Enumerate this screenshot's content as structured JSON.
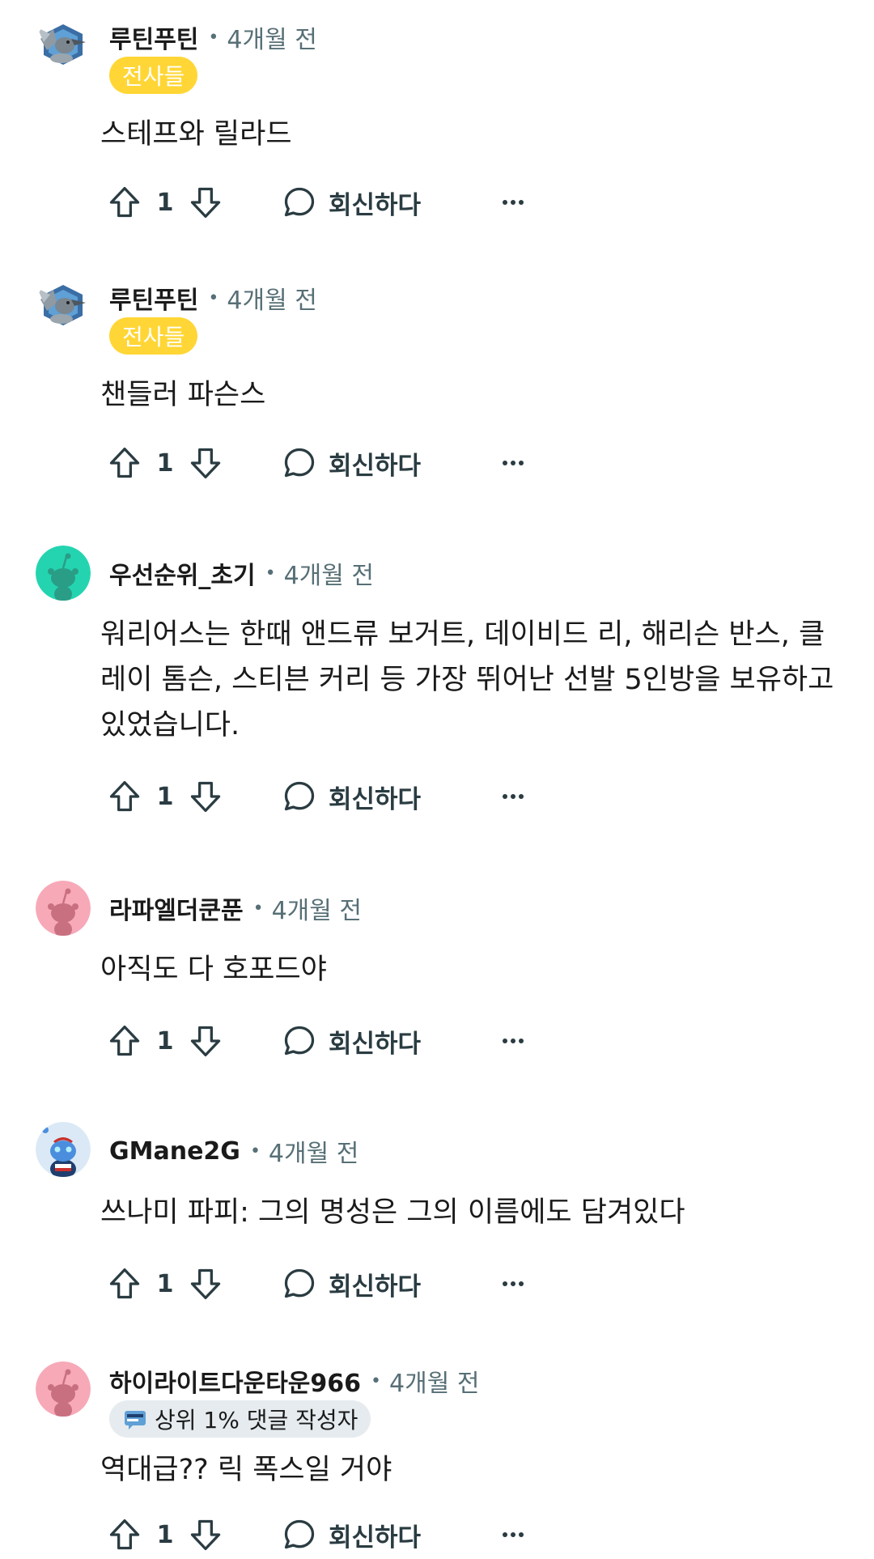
{
  "reply_label": "회신하다",
  "comments": [
    {
      "username": "루틴푸틴",
      "time": "4개월 전",
      "flair": "전사들",
      "body": "스테프와 릴라드",
      "score": "1",
      "avatar": "warrior-bird-avatar"
    },
    {
      "username": "루틴푸틴",
      "time": "4개월 전",
      "flair": "전사들",
      "body": "챈들러 파슨스",
      "score": "1",
      "avatar": "warrior-bird-avatar"
    },
    {
      "username": "우선순위_초기",
      "time": "4개월 전",
      "body": "워리어스는 한때 앤드류 보거트, 데이비드 리, 해리슨 반스, 클레이 톰슨, 스티븐 커리 등 가장 뛰어난 선발 5인방을 보유하고 있었습니다.",
      "score": "1",
      "avatar": "snoo-teal-avatar"
    },
    {
      "username": "라파엘더쿤푼",
      "time": "4개월 전",
      "body": "아직도 다 호포드야",
      "score": "1",
      "avatar": "snoo-pink-avatar"
    },
    {
      "username": "GMane2G",
      "time": "4개월 전",
      "body": "쓰나미 파피: 그의 명성은 그의 이름에도 담겨있다",
      "score": "1",
      "avatar": "snoo-blue-avatar"
    },
    {
      "username": "하이라이트다운타운966",
      "time": "4개월 전",
      "flair": "상위 1% 댓글 작성자",
      "body": "역대급?? 릭 폭스일 거야",
      "score": "1",
      "avatar": "snoo-pink-avatar"
    }
  ],
  "colors": {
    "flair_yellow": "#ffd635",
    "flair_gray": "#e5ebee",
    "meta_gray": "#576f76",
    "action_gray": "#2a3c42"
  },
  "icons": [
    "upvote-icon",
    "downvote-icon",
    "comment-bubble-icon",
    "more-options-icon",
    "top-commenter-icon"
  ]
}
